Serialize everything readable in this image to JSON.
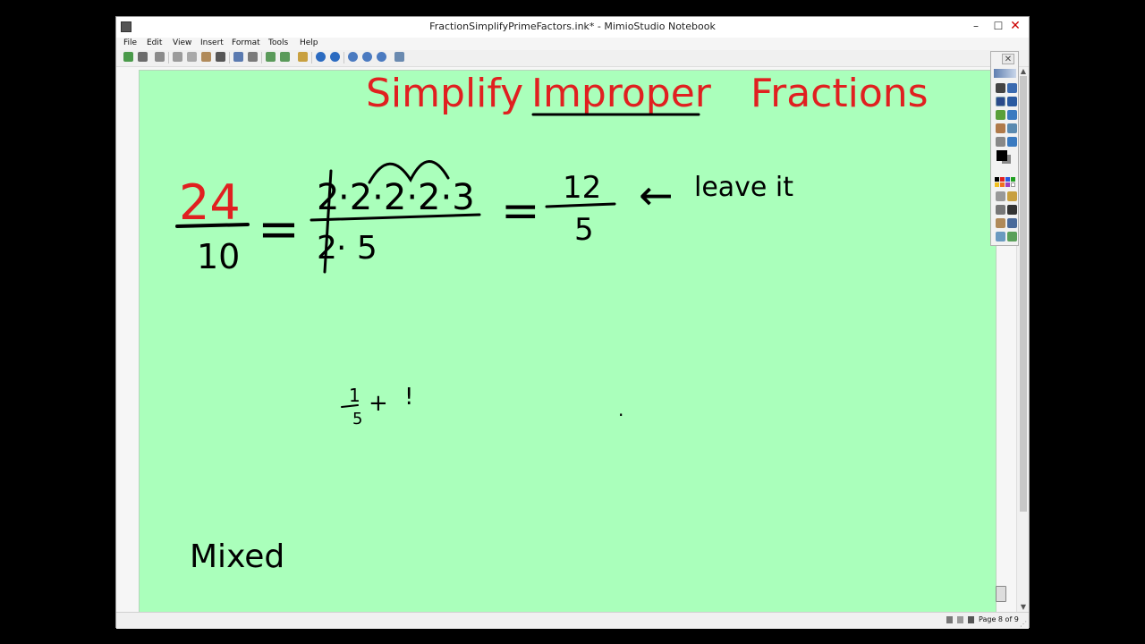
{
  "window": {
    "title": "FractionSimplifyPrimeFactors.ink* - MimioStudio Notebook",
    "minimize_glyph": "–",
    "maximize_glyph": "☐",
    "close_glyph": "✕"
  },
  "menu": [
    "File",
    "Edit",
    "View",
    "Insert",
    "Format",
    "Tools",
    "Help"
  ],
  "toolbar_icons": [
    "new-icon",
    "save-icon",
    "print-icon",
    "cut-icon",
    "copy-icon",
    "paste-icon",
    "delete-icon",
    "undo-icon",
    "redo-icon",
    "add-page-icon",
    "duplicate-page-icon",
    "gallery-icon",
    "back-icon",
    "forward-icon",
    "zoom-icon",
    "zoom-in-icon",
    "zoom-out-icon",
    "fit-page-icon"
  ],
  "ink": {
    "title_prefix": "Simplify",
    "title_underlined": "Improper",
    "title_suffix": "Fractions",
    "frac_num": "24",
    "frac_den": "10",
    "equals": "=",
    "prime_num_1": "2",
    "prime_num_rest": "·2·2·2·3",
    "prime_den_1": "2",
    "prime_den_rest": "· 5",
    "result_num": "12",
    "result_den": "5",
    "arrow": "←",
    "leave_it": "leave it",
    "scratch_1": "1",
    "scratch_5": "5",
    "scratch_plus": "+",
    "scratch_bang": "!",
    "dot": "·",
    "mixed": "Mixed"
  },
  "status": {
    "page_indicator": "Page 8 of 9"
  },
  "colors": {
    "page_background": "#aaffbb",
    "title_ink": "#e02020",
    "red_ink": "#e02020",
    "black_ink": "#000000"
  }
}
